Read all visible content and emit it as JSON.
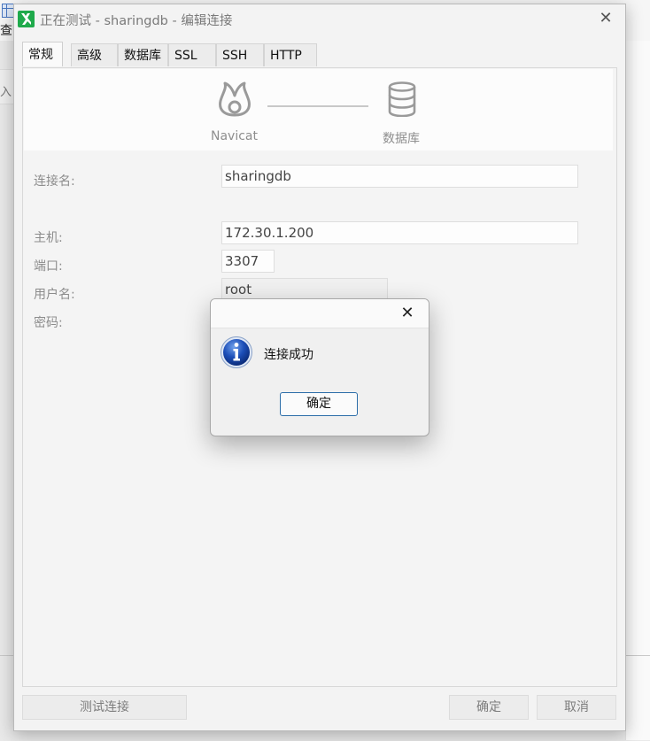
{
  "background": {
    "char_top": "查",
    "char_band": "入"
  },
  "window": {
    "title": "正在测试 - sharingdb - 编辑连接",
    "close_glyph": "✕"
  },
  "tabs": [
    {
      "label": "常规",
      "active": true
    },
    {
      "label": "高级",
      "active": false
    },
    {
      "label": "数据库",
      "active": false
    },
    {
      "label": "SSL",
      "active": false
    },
    {
      "label": "SSH",
      "active": false
    },
    {
      "label": "HTTP",
      "active": false
    }
  ],
  "banner": {
    "left_label": "Navicat",
    "right_label": "数据库",
    "left_icon": "navicat-logo-icon",
    "right_icon": "database-icon"
  },
  "form": {
    "connection_name_label": "连接名:",
    "connection_name_value": "sharingdb",
    "host_label": "主机:",
    "host_value": "172.30.1.200",
    "port_label": "端口:",
    "port_value": "3307",
    "user_label": "用户名:",
    "user_value": "root",
    "password_label": "密码:"
  },
  "buttons": {
    "test": "测试连接",
    "ok": "确定",
    "cancel": "取消"
  },
  "message_box": {
    "icon": "info-icon",
    "text": "连接成功",
    "ok": "确定",
    "close_glyph": "✕"
  },
  "colors": {
    "accent": "#2c6da8",
    "app_icon": "#1faa4b"
  }
}
